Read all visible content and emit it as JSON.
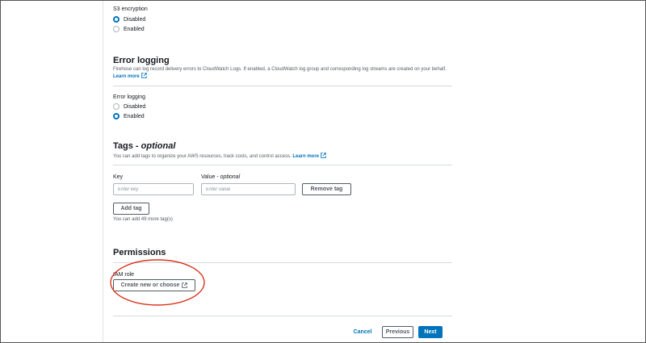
{
  "s3_encryption": {
    "label": "S3 encryption",
    "options": [
      "Disabled",
      "Enabled"
    ],
    "selected": "Disabled"
  },
  "error_logging": {
    "title": "Error logging",
    "description": "Firehose can log record delivery errors to CloudWatch Logs. If enabled, a CloudWatch log group and corresponding log streams are created on your behalf.",
    "learn_more": "Learn more",
    "field_label": "Error logging",
    "options": [
      "Disabled",
      "Enabled"
    ],
    "selected": "Enabled"
  },
  "tags": {
    "title": "Tags - ",
    "title_optional": "optional",
    "description": "You can add tags to organize your AWS resources, track costs, and control access.",
    "learn_more": "Learn more",
    "key_label": "Key",
    "value_label": "Value - ",
    "value_optional": "optional",
    "key_placeholder": "Enter key",
    "value_placeholder": "Enter value",
    "remove_button": "Remove tag",
    "add_button": "Add tag",
    "remaining": "You can add 49 more tag(s)"
  },
  "permissions": {
    "title": "Permissions",
    "iam_label": "IAM role",
    "create_button": "Create new or choose"
  },
  "footer": {
    "cancel": "Cancel",
    "previous": "Previous",
    "next": "Next"
  },
  "colors": {
    "primary": "#0073bb",
    "annotation": "#d9361e"
  }
}
